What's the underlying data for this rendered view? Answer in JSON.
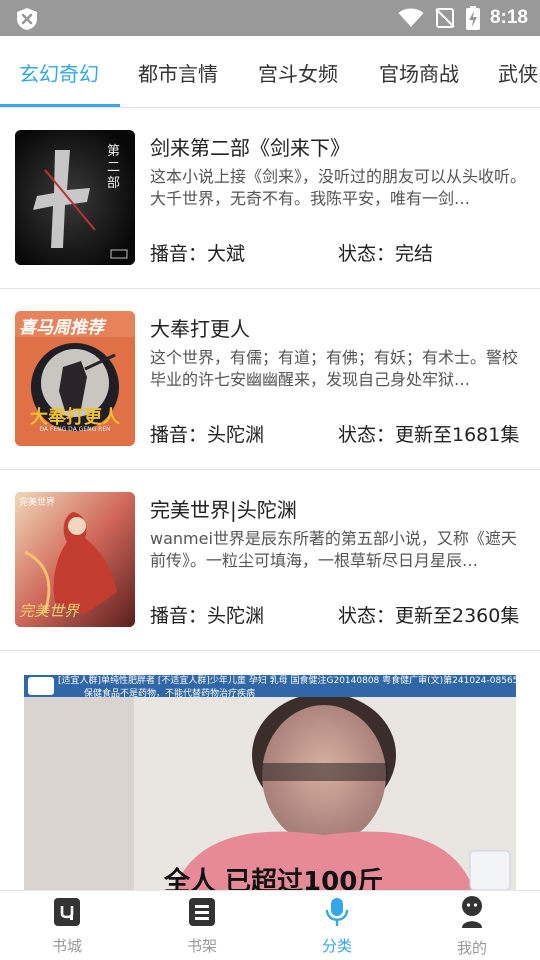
{
  "status_bar": {
    "time": "8:18"
  },
  "tabs": [
    {
      "label": "玄幻奇幻",
      "active": true
    },
    {
      "label": "都市言情",
      "active": false
    },
    {
      "label": "宫斗女频",
      "active": false
    },
    {
      "label": "官场商战",
      "active": false
    },
    {
      "label": "武侠",
      "active": false
    }
  ],
  "books": [
    {
      "title": "剑来第二部《剑来下》",
      "description": "这本小说上接《剑来》，没听过的朋友可以从头收听。大千世界，无奇不有。我陈平安，唯有一剑…",
      "narrator": "播音：大斌",
      "status": "状态：完结",
      "cover": {
        "text_main": "剑来",
        "text_side": "第二部"
      }
    },
    {
      "title": "大奉打更人",
      "description": "这个世界，有儒；有道；有佛；有妖；有术士。警校毕业的许七安幽幽醒来，发现自己身处牢狱…",
      "narrator": "播音：头陀渊",
      "status": "状态：更新至1681集",
      "cover": {
        "text_top": "喜马周推荐",
        "text_main": "大奉打更人",
        "text_sub": "DA FENG DA GENG REN"
      }
    },
    {
      "title": "完美世界|头陀渊",
      "description": "wanmei世界是辰东所著的第五部小说，又称《遮天前传》。一粒尘可填海，一根草斩尽日月星辰…",
      "narrator": "播音：头陀渊",
      "status": "状态：更新至2360集",
      "cover": {
        "text_top": "完美世界",
        "text_main": "完美世界"
      }
    }
  ],
  "ad": {
    "strip_text": "[适宜人群]单纯性肥胖者 [不适宜人群]少年儿童 孕妇 乳母  国食健注G20140808  粤食健广审(文)第241024-08565号",
    "warning": "保健食品不是药物，不能代替药物治疗疾病",
    "caption": "全人  已超过100斤"
  },
  "bottom_nav": [
    {
      "label": "书城",
      "icon": "bookstore-icon",
      "active": false
    },
    {
      "label": "书架",
      "icon": "bookshelf-icon",
      "active": false
    },
    {
      "label": "分类",
      "icon": "microphone-icon",
      "active": true
    },
    {
      "label": "我的",
      "icon": "profile-icon",
      "active": false
    }
  ],
  "colors": {
    "accent": "#34a7e7",
    "status_bar": "#999999",
    "text": "#222222"
  }
}
